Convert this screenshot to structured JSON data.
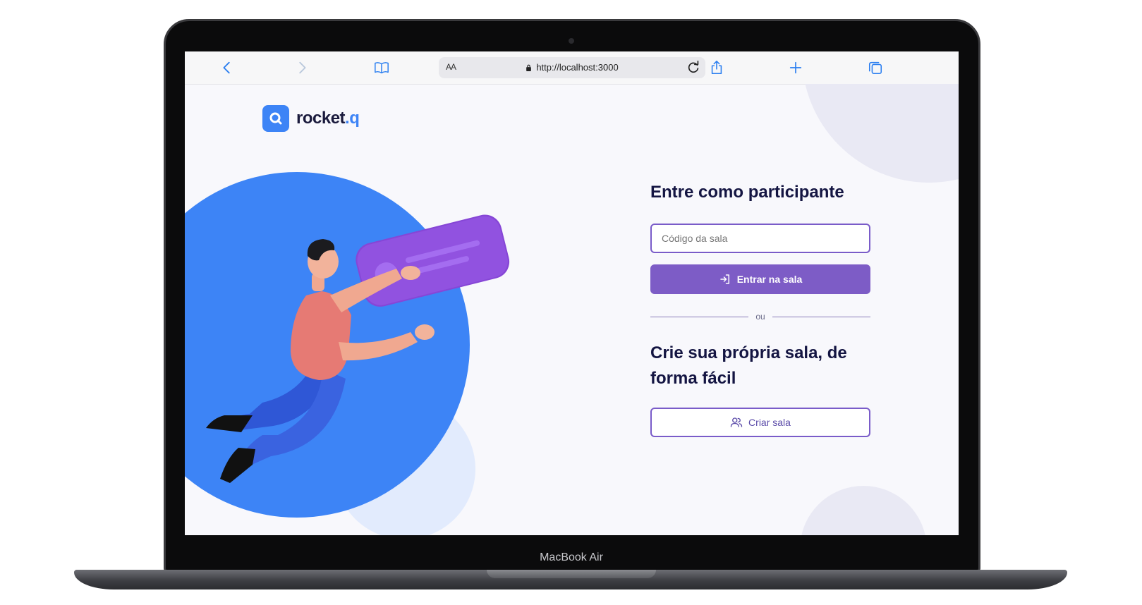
{
  "device": {
    "model_label": "MacBook Air"
  },
  "browser": {
    "address_text_size_label": "AA",
    "url": "http://localhost:3000",
    "icons": [
      "chevron-left-icon",
      "chevron-right-icon",
      "book-icon",
      "lock-icon",
      "reload-icon",
      "share-icon",
      "plus-icon",
      "tabs-icon"
    ]
  },
  "app": {
    "logo_text_main": "rocket",
    "logo_text_dot": ".q",
    "brand_colors": {
      "primary": "#3d84f6",
      "accent": "#7d5cc6",
      "heading": "#141542"
    }
  },
  "join": {
    "heading": "Entre como participante",
    "input_placeholder": "Código da sala",
    "input_value": "",
    "button_label": "Entrar na sala"
  },
  "divider": {
    "label": "ou"
  },
  "create": {
    "heading": "Crie sua própria sala, de forma fácil",
    "button_label": "Criar sala"
  }
}
